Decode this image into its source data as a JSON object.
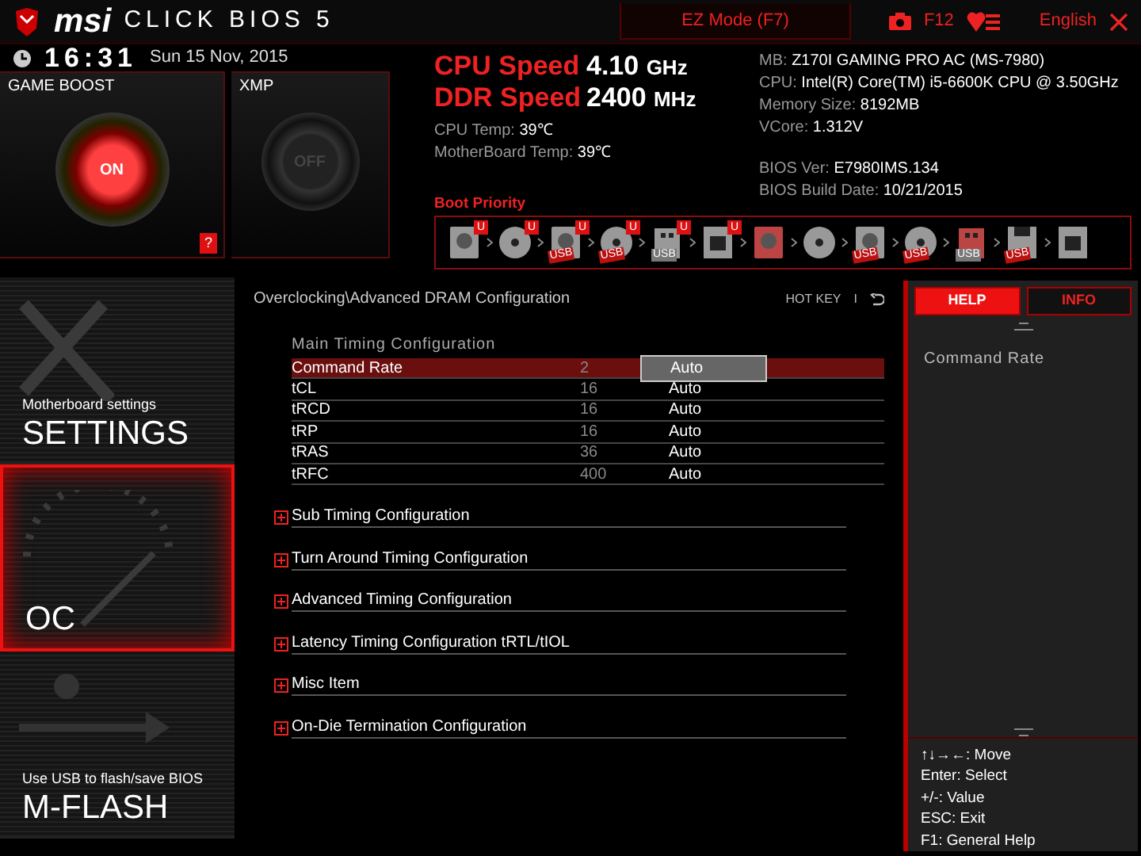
{
  "header": {
    "brand": "msi",
    "product": "CLICK BIOS 5",
    "ez_mode": "EZ Mode (F7)",
    "screenshot_key": "F12",
    "language": "English"
  },
  "clock": {
    "time": "16:31",
    "date": "Sun  15 Nov, 2015"
  },
  "game_boost": {
    "title": "GAME BOOST",
    "on": true,
    "state": "ON",
    "help": "?"
  },
  "xmp": {
    "title": "XMP",
    "on": false,
    "state": "OFF"
  },
  "speeds": [
    {
      "label": "CPU Speed",
      "value": "4.10",
      "unit": "GHz"
    },
    {
      "label": "DDR Speed",
      "value": "2400",
      "unit": "MHz"
    }
  ],
  "temps": [
    {
      "label": "CPU Temp:",
      "value": "39℃"
    },
    {
      "label": "MotherBoard Temp:",
      "value": "39℃"
    }
  ],
  "system_info": [
    {
      "label": "MB:",
      "value": "Z170I GAMING PRO AC (MS-7980)"
    },
    {
      "label": "CPU:",
      "value": "Intel(R) Core(TM) i5-6600K CPU @ 3.50GHz"
    },
    {
      "label": "Memory Size:",
      "value": "8192MB"
    },
    {
      "label": "VCore:",
      "value": "1.312V"
    }
  ],
  "bios_info": [
    {
      "label": "BIOS Ver:",
      "value": "E7980IMS.134"
    },
    {
      "label": "BIOS Build Date:",
      "value": "10/21/2015"
    }
  ],
  "boot_priority": {
    "title": "Boot Priority",
    "devices": [
      {
        "kind": "hdd",
        "badge": "U",
        "highlighted": false
      },
      {
        "kind": "optical",
        "badge": "U",
        "highlighted": false
      },
      {
        "kind": "hdd",
        "badge": "U",
        "label": "USB",
        "highlighted": false
      },
      {
        "kind": "optical",
        "badge": "U",
        "label": "USB",
        "highlighted": false
      },
      {
        "kind": "usbkey",
        "badge": "U",
        "label": "USB",
        "highlighted": false
      },
      {
        "kind": "network",
        "badge": "U",
        "highlighted": false
      },
      {
        "kind": "hdd",
        "highlighted": true
      },
      {
        "kind": "optical",
        "highlighted": false
      },
      {
        "kind": "hdd",
        "label": "USB",
        "highlighted": false
      },
      {
        "kind": "optical",
        "label": "USB",
        "highlighted": false
      },
      {
        "kind": "usbkey",
        "label": "USB",
        "highlighted": true
      },
      {
        "kind": "floppy",
        "label": "USB",
        "highlighted": false
      },
      {
        "kind": "network",
        "highlighted": false
      }
    ]
  },
  "sidebar": {
    "items": [
      {
        "kind": "settings",
        "subtitle": "Motherboard settings",
        "title": "SETTINGS",
        "selected": false
      },
      {
        "kind": "oc",
        "title": "OC",
        "selected": true
      },
      {
        "kind": "mflash",
        "subtitle": "Use USB to flash/save BIOS",
        "title": "M-FLASH",
        "selected": false
      }
    ]
  },
  "main": {
    "breadcrumb": "Overclocking\\Advanced DRAM Configuration",
    "hot_key": "HOT KEY",
    "separator": "I",
    "group_title": "Main  Timing  Configuration",
    "rows": [
      {
        "name": "Command Rate",
        "current": "2",
        "value": "Auto",
        "selected": true
      },
      {
        "name": "tCL",
        "current": "16",
        "value": "Auto",
        "selected": false
      },
      {
        "name": "tRCD",
        "current": "16",
        "value": "Auto",
        "selected": false
      },
      {
        "name": "tRP",
        "current": "16",
        "value": "Auto",
        "selected": false
      },
      {
        "name": "tRAS",
        "current": "36",
        "value": "Auto",
        "selected": false
      },
      {
        "name": "tRFC",
        "current": "400",
        "value": "Auto",
        "selected": false
      }
    ],
    "submenus": [
      {
        "label": "Sub Timing Configuration",
        "expanded": false
      },
      {
        "label": "Turn Around Timing Configuration",
        "expanded": false
      },
      {
        "label": "Advanced Timing Configuration",
        "expanded": false
      },
      {
        "label": "Latency Timing Configuration tRTL/tIOL",
        "expanded": false
      },
      {
        "label": "Misc Item",
        "expanded": false
      },
      {
        "label": "On-Die Termination Configuration",
        "expanded": false
      }
    ]
  },
  "help_panel": {
    "tabs": [
      {
        "label": "HELP",
        "selected": true
      },
      {
        "label": "INFO",
        "selected": false
      }
    ],
    "text": "Command  Rate",
    "keys": [
      "↑↓→←:  Move",
      "Enter:  Select",
      "+/-:  Value",
      "ESC:  Exit",
      "F1:  General  Help"
    ]
  }
}
